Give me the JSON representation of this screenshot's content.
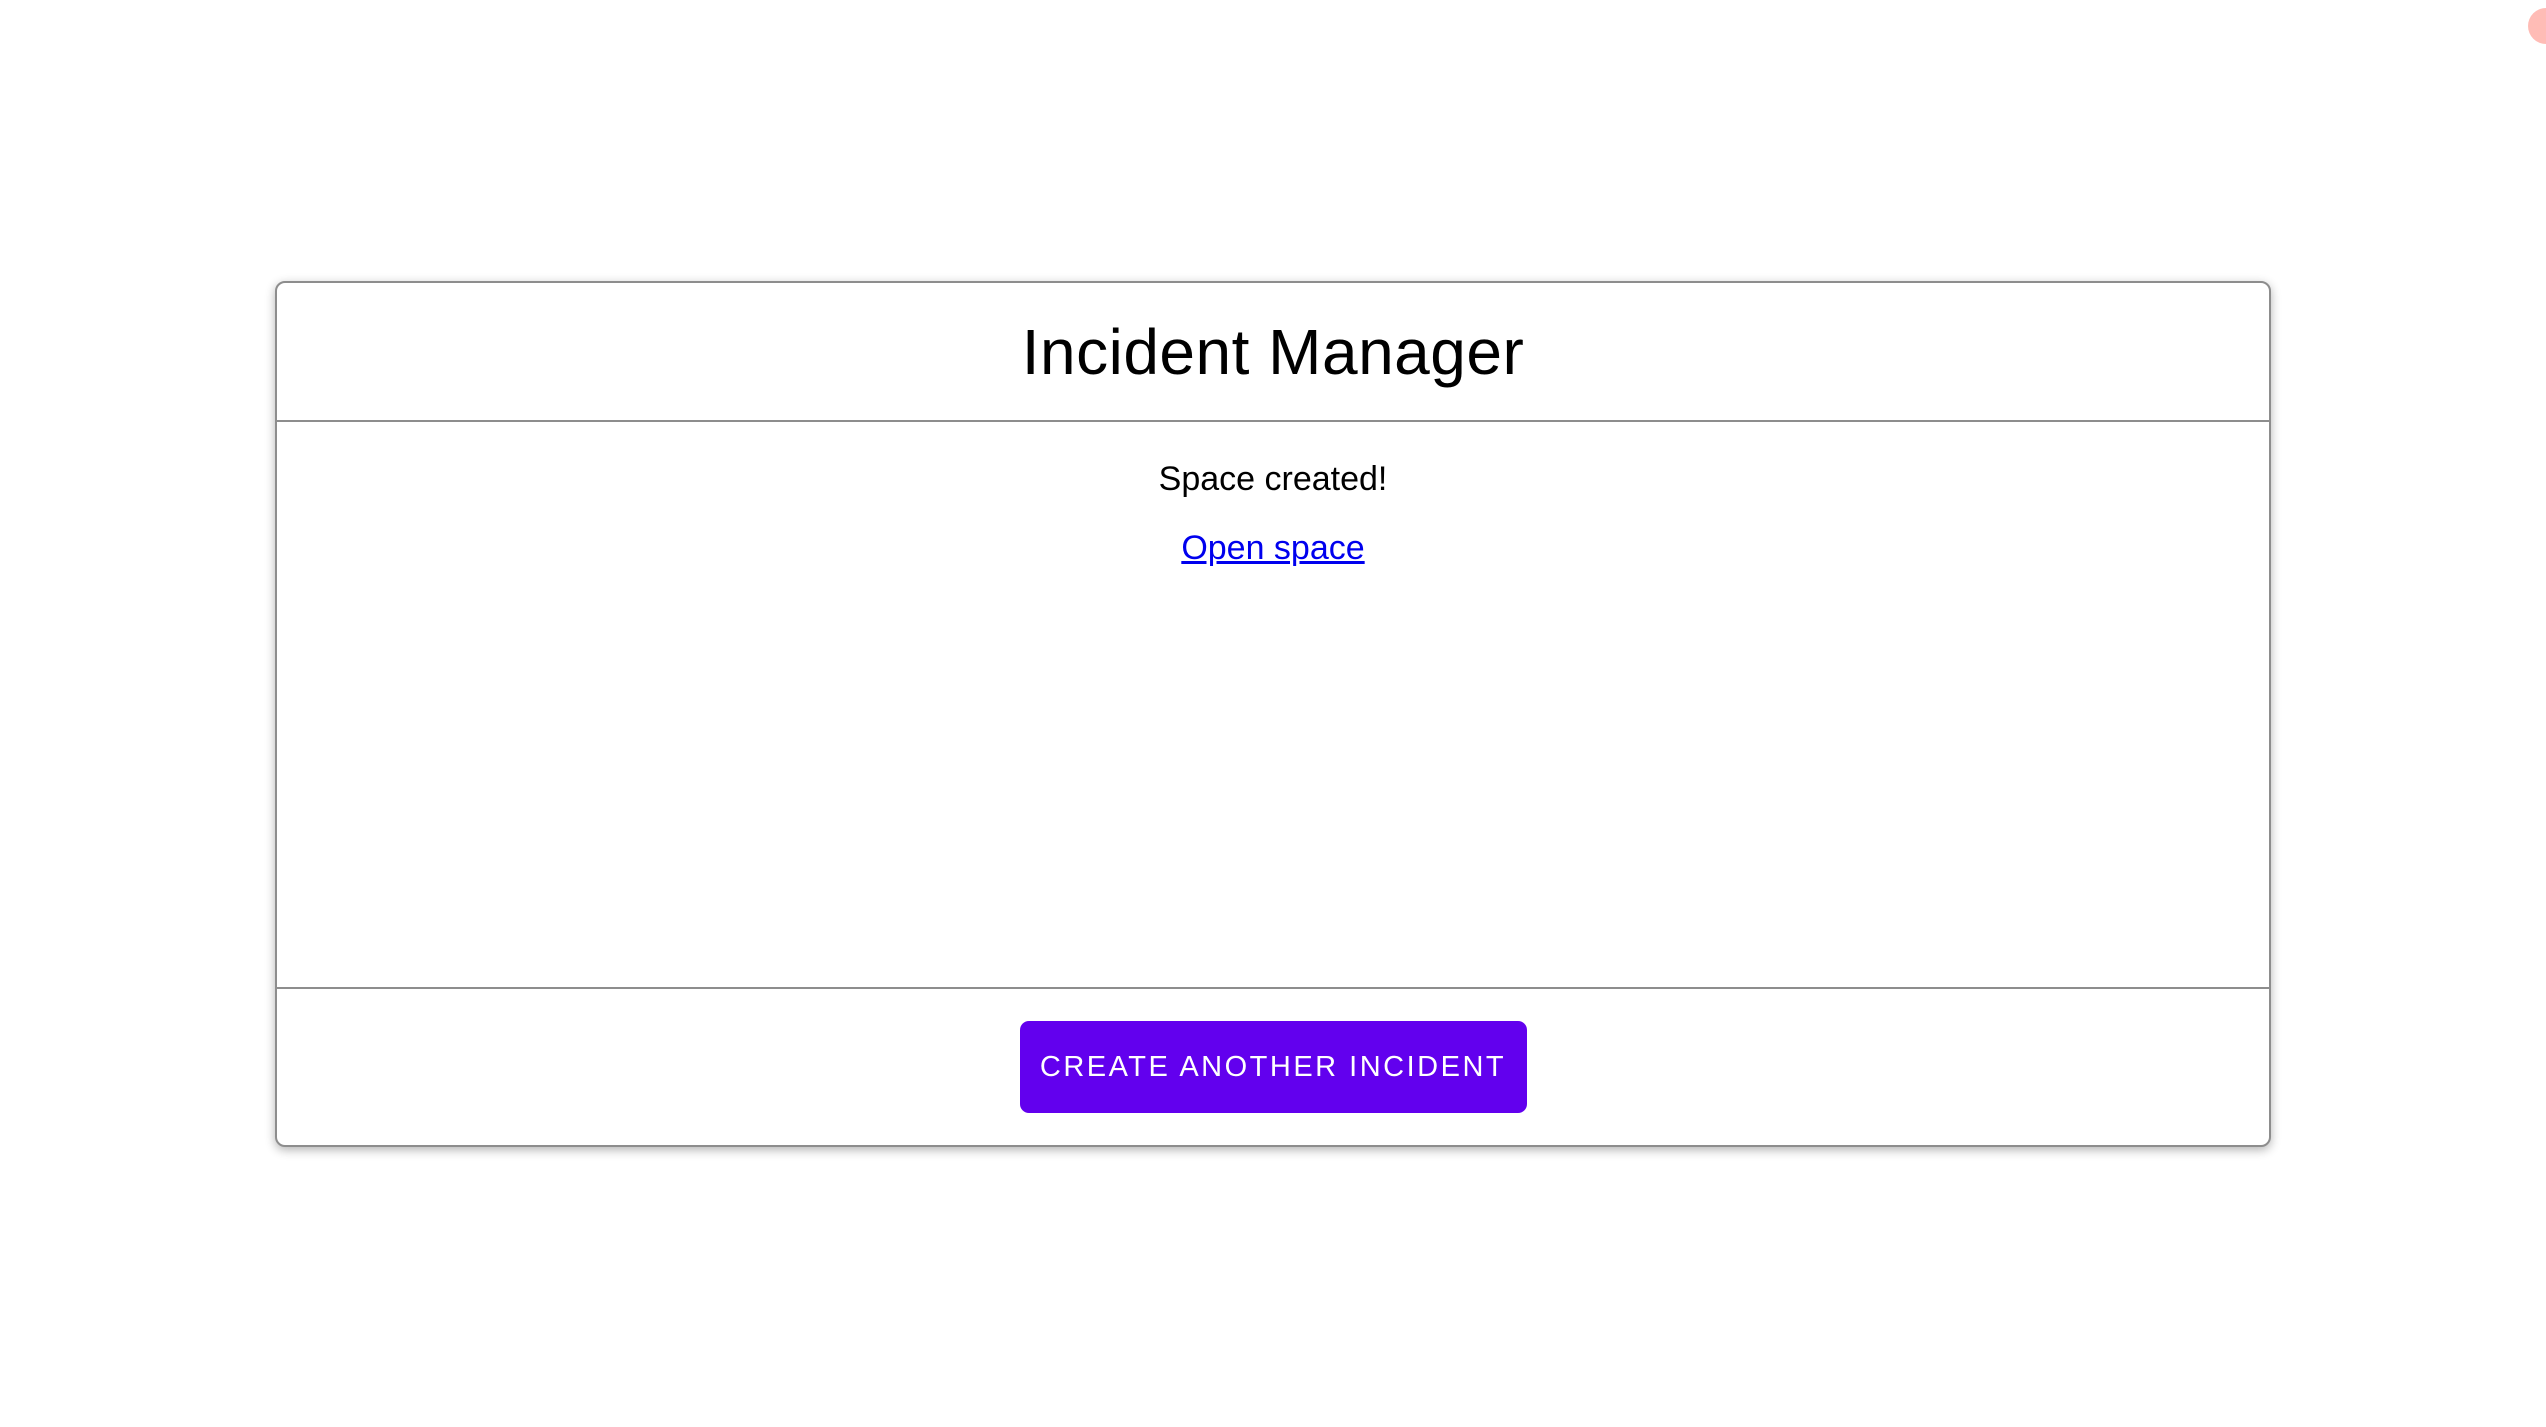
{
  "card": {
    "header": {
      "title": "Incident Manager"
    },
    "body": {
      "status_message": "Space created!",
      "link_label": "Open space"
    },
    "footer": {
      "button_label": "CREATE ANOTHER INCIDENT"
    }
  },
  "colors": {
    "accent_purple": "#6200EE",
    "link_blue": "#0000EE",
    "border_gray": "#8d8d8d",
    "corner_indicator_red": "#ff6b5e",
    "text_black": "#000000",
    "background_white": "#ffffff"
  }
}
